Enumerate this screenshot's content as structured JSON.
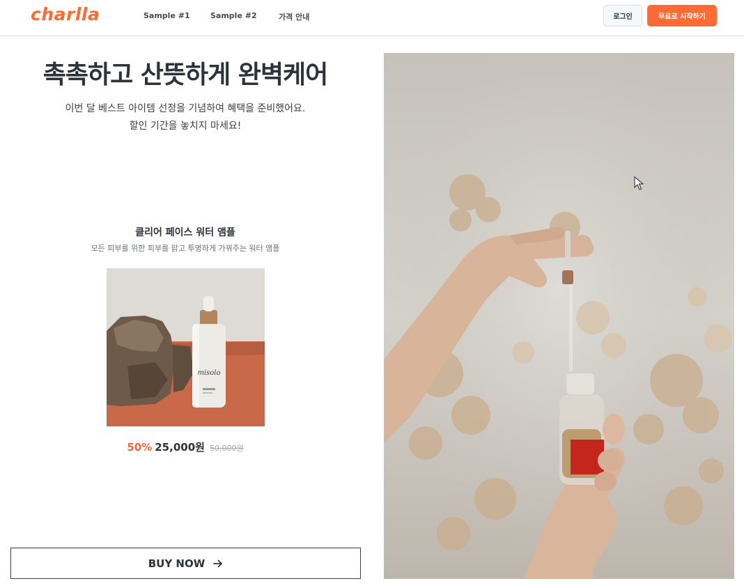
{
  "header": {
    "logo": "charlla",
    "nav": [
      "Sample #1",
      "Sample #2",
      "가격 안내"
    ],
    "login_label": "로그인",
    "start_label": "무료로 시작하기"
  },
  "hero": {
    "title": "촉촉하고 산뜻하게 완벽케어",
    "subtitle_line1": "이번 달 베스트 아이템 선정을 기념하여 혜택을 준비했어요.",
    "subtitle_line2": "할인 기간을 놓치지 마세요!"
  },
  "product": {
    "name": "클리어 페이스 워터 앰플",
    "description": "모든 피부를 위한 피부를 맑고 투명하게 가꿔주는 워터 앰플",
    "bottle_brand": "misolo",
    "discount": "50%",
    "price": "25,000원",
    "original_price": "50,000원"
  },
  "cta": {
    "buy_label": "BUY NOW"
  },
  "colors": {
    "accent": "#ff6b35",
    "discount": "#ee6a3d",
    "text": "#2e333b"
  }
}
